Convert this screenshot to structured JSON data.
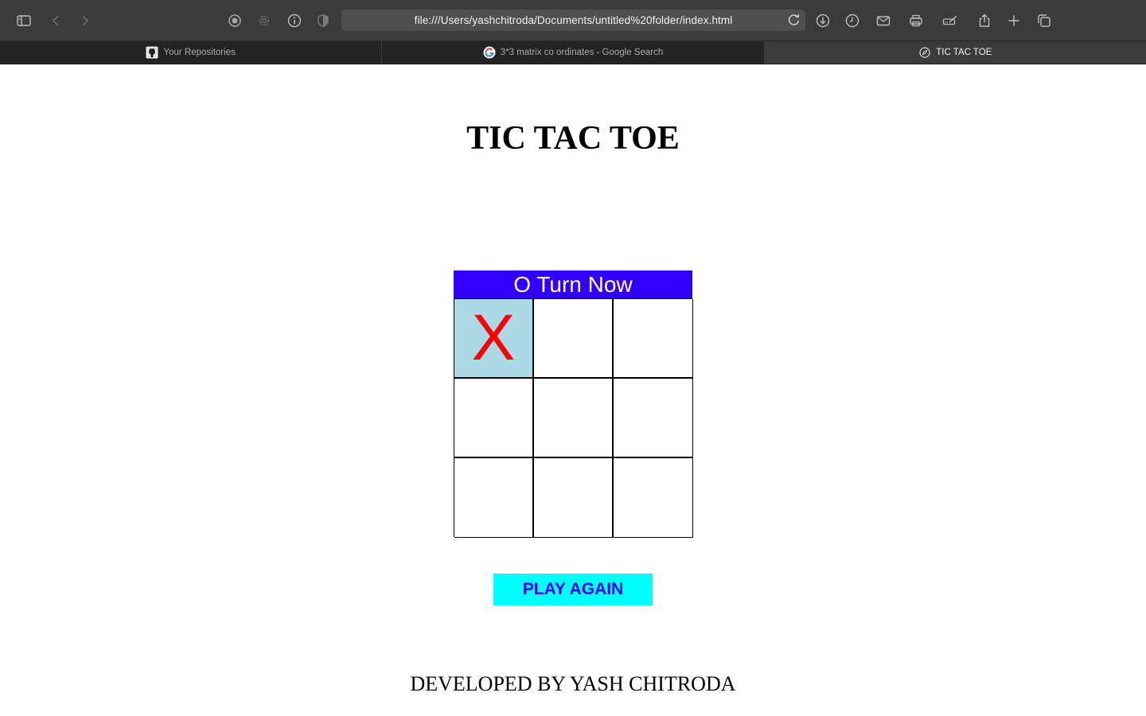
{
  "browser": {
    "url": "file:///Users/yashchitroda/Documents/untitled%20folder/index.html",
    "tabs": [
      {
        "label": "Your Repositories",
        "icon": "github-icon",
        "active": false
      },
      {
        "label": "3*3 matrix co ordinates - Google Search",
        "icon": "google-icon",
        "active": false
      },
      {
        "label": "TIC TAC TOE",
        "icon": "compass-icon",
        "active": true
      }
    ]
  },
  "page": {
    "title": "TIC TAC TOE",
    "turn_text": "O Turn Now",
    "board": [
      "X",
      "",
      "",
      "",
      "",
      "",
      "",
      "",
      ""
    ],
    "play_again_label": "PLAY AGAIN",
    "footer": "DEVELOPED BY YASH CHITRODA"
  },
  "colors": {
    "banner_bg": "#3300ff",
    "mark_x": "#ff0000",
    "filled_cell_bg": "#add8e6",
    "button_bg": "#00ffff",
    "button_text": "#3300ff"
  }
}
